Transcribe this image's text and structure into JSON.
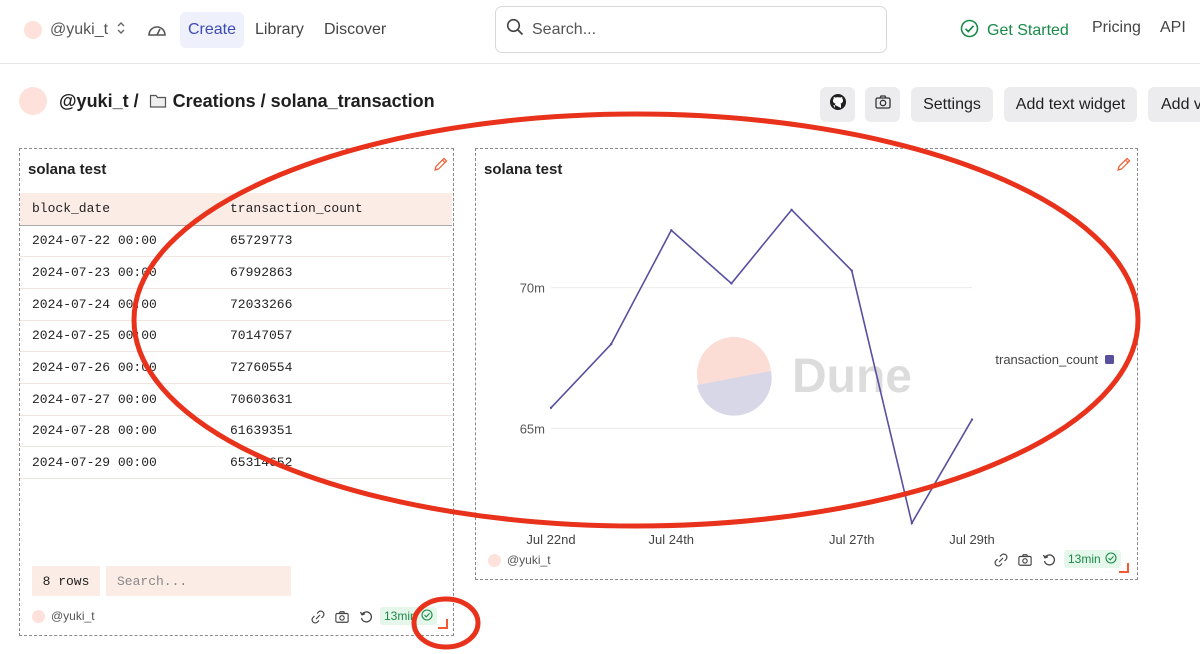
{
  "nav": {
    "username": "@yuki_t",
    "links": [
      "Create",
      "Library",
      "Discover"
    ],
    "search_placeholder": "Search...",
    "get_started": "Get Started",
    "pricing": "Pricing",
    "api": "API"
  },
  "breadcrumb": {
    "user": "@yuki_t /",
    "path": "Creations / solana_transaction"
  },
  "toolbar": {
    "settings": "Settings",
    "add_text_widget": "Add text widget",
    "add_visualization": "Add v"
  },
  "table_widget": {
    "title": "solana test",
    "columns": [
      "block_date",
      "transaction_count"
    ],
    "rows": [
      [
        "2024-07-22 00:00",
        "65729773"
      ],
      [
        "2024-07-23 00:00",
        "67992863"
      ],
      [
        "2024-07-24 00:00",
        "72033266"
      ],
      [
        "2024-07-25 00:00",
        "70147057"
      ],
      [
        "2024-07-26 00:00",
        "72760554"
      ],
      [
        "2024-07-27 00:00",
        "70603631"
      ],
      [
        "2024-07-28 00:00",
        "61639351"
      ],
      [
        "2024-07-29 00:00",
        "65314652"
      ]
    ],
    "row_count": "8 rows",
    "search_placeholder": "Search...",
    "author": "@yuki_t",
    "age": "13min"
  },
  "chart_widget": {
    "title": "solana test",
    "author": "@yuki_t",
    "age": "13min",
    "watermark": "Dune"
  },
  "chart_data": {
    "type": "line",
    "x": [
      "2024-07-22",
      "2024-07-23",
      "2024-07-24",
      "2024-07-25",
      "2024-07-26",
      "2024-07-27",
      "2024-07-28",
      "2024-07-29"
    ],
    "x_tick_labels": [
      "Jul 22nd",
      "Jul 24th",
      "Jul 27th",
      "Jul 29th"
    ],
    "x_tick_dates": [
      "2024-07-22",
      "2024-07-24",
      "2024-07-27",
      "2024-07-29"
    ],
    "y_tick_labels": [
      "70m",
      "65m"
    ],
    "y_tick_values": [
      70000000,
      65000000
    ],
    "ylim": [
      61500000,
      73500000
    ],
    "series": [
      {
        "name": "transaction_count",
        "values": [
          65729773,
          67992863,
          72033266,
          70147057,
          72760554,
          70603631,
          61639351,
          65314652
        ],
        "color": "#58509d"
      }
    ],
    "legend_position": "right",
    "grid": true
  },
  "colors": {
    "accent": "#3c4bb5",
    "success": "#1a8a4a",
    "annotation": "#e8321c",
    "table_header": "#fcece6"
  }
}
